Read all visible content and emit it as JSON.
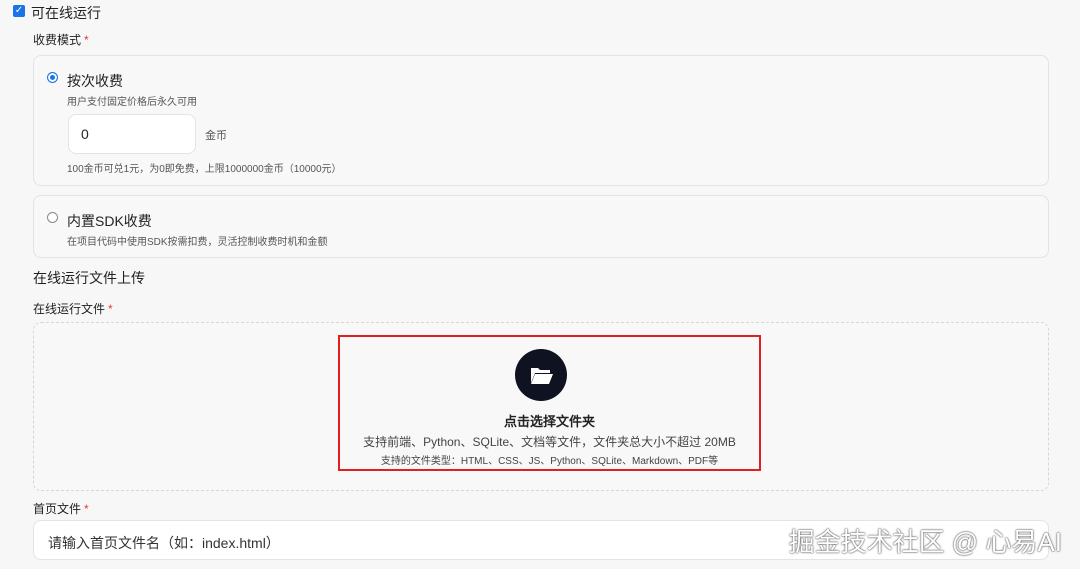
{
  "online_run": {
    "label": "可在线运行",
    "checked": true
  },
  "pricing": {
    "label": "收费模式",
    "per_use": {
      "title": "按次收费",
      "desc": "用户支付固定价格后永久可用",
      "value": "0",
      "unit": "金币",
      "hint": "100金币可兑1元，为0即免费，上限1000000金币（10000元）",
      "selected": true
    },
    "sdk": {
      "title": "内置SDK收费",
      "desc": "在项目代码中使用SDK按需扣费，灵活控制收费时机和金额",
      "selected": false
    }
  },
  "upload": {
    "section_title": "在线运行文件上传",
    "field_label": "在线运行文件",
    "title": "点击选择文件夹",
    "desc": "支持前端、Python、SQLite、文档等文件，文件夹总大小不超过 20MB",
    "types": "支持的文件类型：HTML、CSS、JS、Python、SQLite、Markdown、PDF等"
  },
  "homepage": {
    "label": "首页文件",
    "placeholder": "请输入首页文件名（如：index.html）"
  },
  "watermark": "掘金技术社区 @ 心易AI"
}
